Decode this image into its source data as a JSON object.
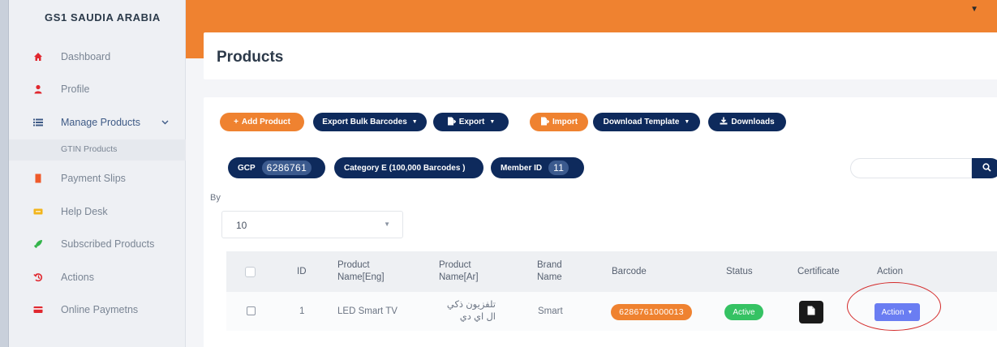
{
  "sidebar": {
    "brand": "GS1 SAUDIA ARABIA",
    "items": [
      {
        "label": "Dashboard",
        "icon": "home-icon",
        "color": "#e0282f"
      },
      {
        "label": "Profile",
        "icon": "user-icon",
        "color": "#e0282f"
      },
      {
        "label": "Manage Products",
        "icon": "list-icon",
        "color": "#3e5a86"
      },
      {
        "label": "Payment Slips",
        "icon": "receipt-icon",
        "color": "#ef5a2a"
      },
      {
        "label": "Help Desk",
        "icon": "ticket-icon",
        "color": "#f2b51c"
      },
      {
        "label": "Subscribed Products",
        "icon": "rocket-icon",
        "color": "#33b44a"
      },
      {
        "label": "Actions",
        "icon": "history-icon",
        "color": "#e0282f"
      },
      {
        "label": "Online Paymetns",
        "icon": "credit-card-icon",
        "color": "#e0282f"
      }
    ],
    "sub_item": "GTIN Products"
  },
  "header": {
    "title": "Products"
  },
  "toolbar": {
    "add_product": "Add Product",
    "export_bulk_barcodes": "Export Bulk Barcodes",
    "export": "Export",
    "import": "Import",
    "download_template": "Download Template",
    "downloads": "Downloads"
  },
  "info": {
    "gcp_label": "GCP",
    "gcp_value": "6286761",
    "category": "Category E (100,000 Barcodes )",
    "member_label": "Member ID",
    "member_value": "11"
  },
  "filter": {
    "by_label": "By",
    "page_size": "10"
  },
  "table": {
    "headers": [
      "ID",
      "Product Name[Eng]",
      "Product Name[Ar]",
      "Brand Name",
      "Barcode",
      "Status",
      "Certificate",
      "Action"
    ],
    "rows": [
      {
        "id": "1",
        "name_en": "LED Smart TV",
        "name_ar": "تلفزيون ذكي ال اي دي",
        "brand": "Smart",
        "barcode": "6286761000013",
        "status": "Active",
        "action": "Action"
      }
    ]
  },
  "colors": {
    "accent": "#ef8230",
    "navy": "#0e2a5c",
    "active_status": "#35c263",
    "action_button": "#6a7df2",
    "highlight_circle": "#d42b2b"
  }
}
